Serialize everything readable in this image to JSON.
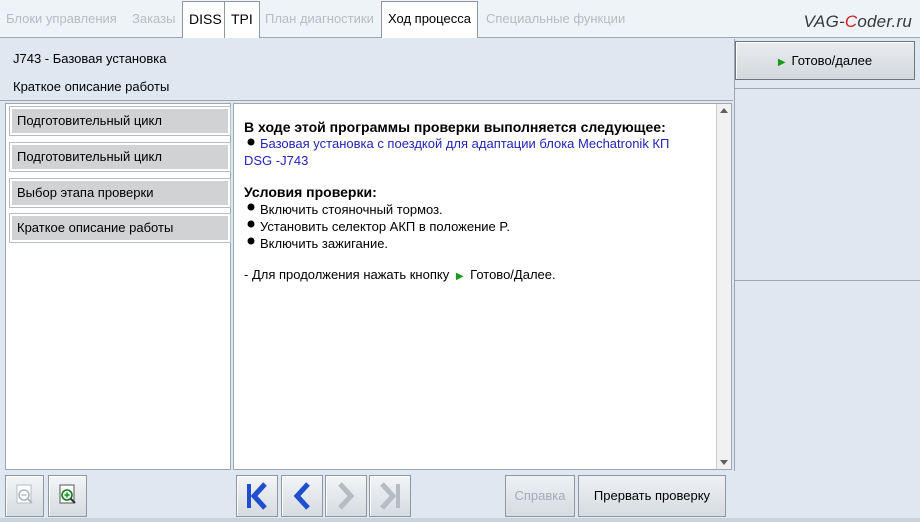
{
  "tabs": [
    {
      "label": "Блоки управления",
      "active": false
    },
    {
      "label": "Заказы",
      "active": false
    },
    {
      "label": "DISS",
      "active": true
    },
    {
      "label": "TPI",
      "active": true
    },
    {
      "label": "План диагностики",
      "active": false
    },
    {
      "label": "Ход процесса",
      "active": true
    },
    {
      "label": "Специальные функции",
      "active": false
    }
  ],
  "logo": {
    "pre": "VAG-",
    "accent": "C",
    "post": "oder.ru"
  },
  "header": {
    "title": "J743 - Базовая установка",
    "subtitle": "Краткое описание работы"
  },
  "done_button": "Готово/далее",
  "steps": [
    "Подготовительный цикл",
    "Подготовительный цикл",
    "Выбор этапа проверки",
    "Краткое описание работы"
  ],
  "content": {
    "heading": "В ходе этой программы проверки выполняется следующее:",
    "link_line1": "Базовая установка с поездкой для адаптации блока Mechatronik КП",
    "link_line2": "DSG -J743",
    "conditions_heading": "Условия проверки:",
    "conditions": [
      "Включить стояночный тормоз.",
      "Установить селектор АКП в положение P.",
      "Включить зажигание."
    ],
    "continue_pre": "- Для продолжения нажать кнопку",
    "continue_post": "Готово/Далее."
  },
  "bottom": {
    "help_label": "Справка",
    "abort_label": "Прервать проверку"
  },
  "icons": [
    "zoom-out-icon",
    "zoom-in-icon",
    "first-step-icon",
    "previous-step-icon",
    "next-step-icon",
    "last-step-icon",
    "play-icon",
    "bullet-icon"
  ],
  "colors": {
    "link": "#2424b8",
    "play": "#1a9a1a",
    "nav_blue": "#1f4fd0",
    "logo_accent": "#d42020"
  }
}
